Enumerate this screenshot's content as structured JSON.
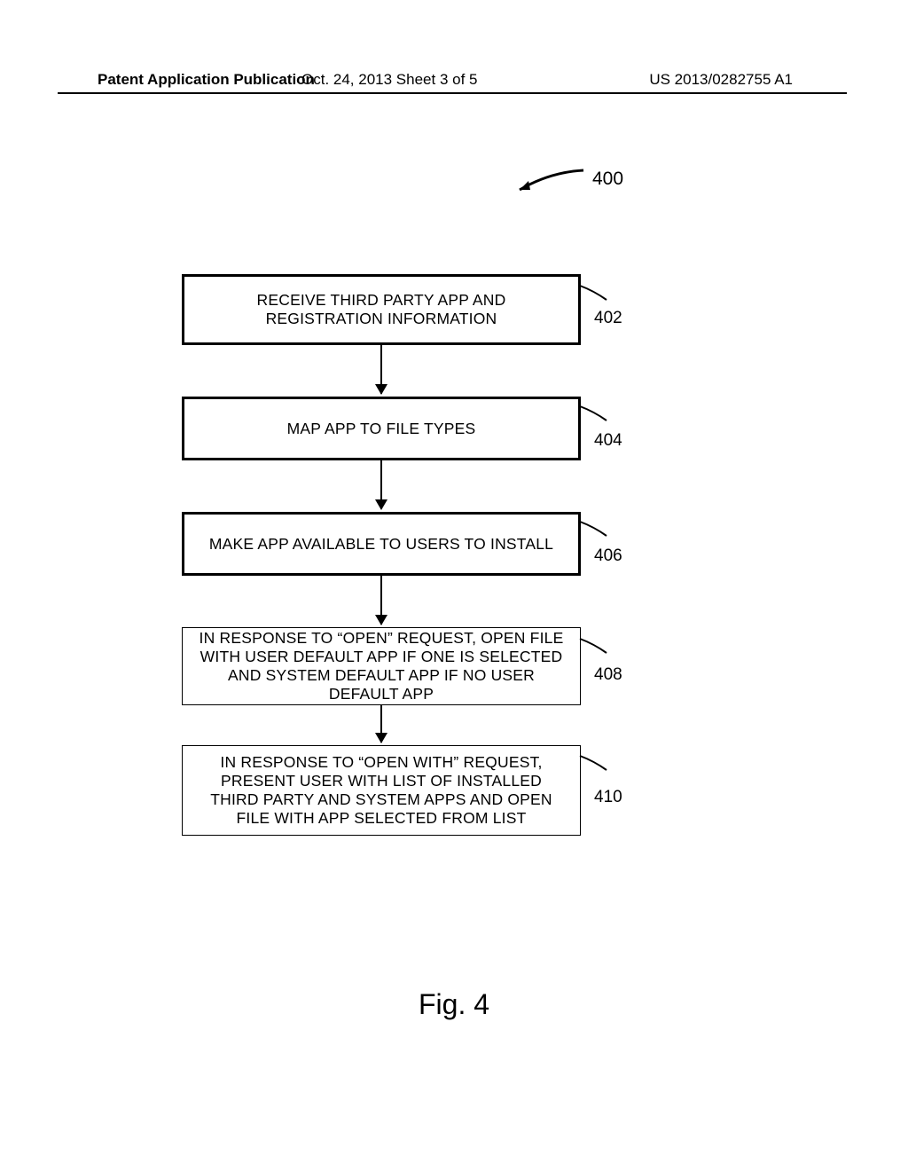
{
  "header": {
    "left": "Patent Application Publication",
    "center": "Oct. 24, 2013  Sheet 3 of 5",
    "right": "US 2013/0282755 A1"
  },
  "ref": "400",
  "boxes": {
    "b1": {
      "text": "RECEIVE THIRD PARTY APP AND REGISTRATION INFORMATION",
      "num": "402"
    },
    "b2": {
      "text": "MAP APP TO FILE TYPES",
      "num": "404"
    },
    "b3": {
      "text": "MAKE APP AVAILABLE TO USERS TO INSTALL",
      "num": "406"
    },
    "b4": {
      "text": "IN RESPONSE TO “OPEN” REQUEST, OPEN FILE WITH USER DEFAULT APP IF ONE IS SELECTED AND SYSTEM DEFAULT APP IF NO USER DEFAULT APP",
      "num": "408"
    },
    "b5": {
      "text": "IN RESPONSE TO “OPEN WITH” REQUEST, PRESENT USER WITH LIST OF INSTALLED THIRD PARTY AND SYSTEM APPS AND OPEN FILE WITH APP SELECTED FROM LIST",
      "num": "410"
    }
  },
  "figure": "Fig. 4"
}
